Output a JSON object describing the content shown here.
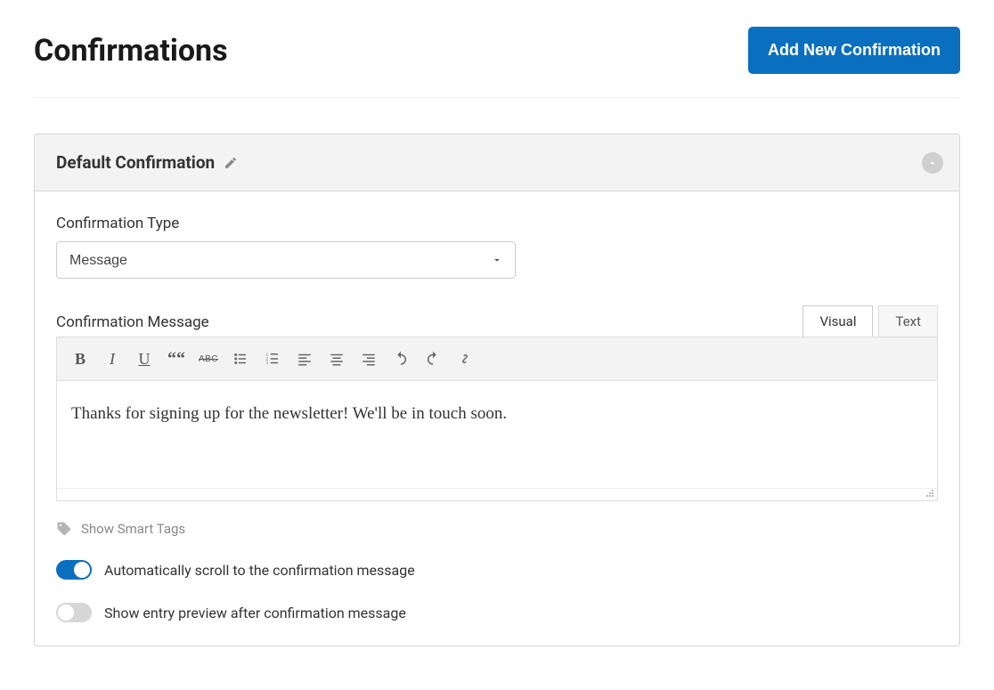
{
  "header": {
    "title": "Confirmations",
    "add_button": "Add New Confirmation"
  },
  "panel": {
    "title": "Default Confirmation"
  },
  "type_field": {
    "label": "Confirmation Type",
    "value": "Message"
  },
  "message_field": {
    "label": "Confirmation Message",
    "tabs": {
      "visual": "Visual",
      "text": "Text"
    },
    "content": "Thanks for signing up for the newsletter! We'll be in touch soon."
  },
  "smart_tags": {
    "label": "Show Smart Tags"
  },
  "toggles": {
    "scroll": {
      "label": "Automatically scroll to the confirmation message",
      "on": true
    },
    "preview": {
      "label": "Show entry preview after confirmation message",
      "on": false
    }
  },
  "toolbar_icons": {
    "bold": "B",
    "italic": "I",
    "underline": "U",
    "quote": "““",
    "strike": "ABC"
  }
}
